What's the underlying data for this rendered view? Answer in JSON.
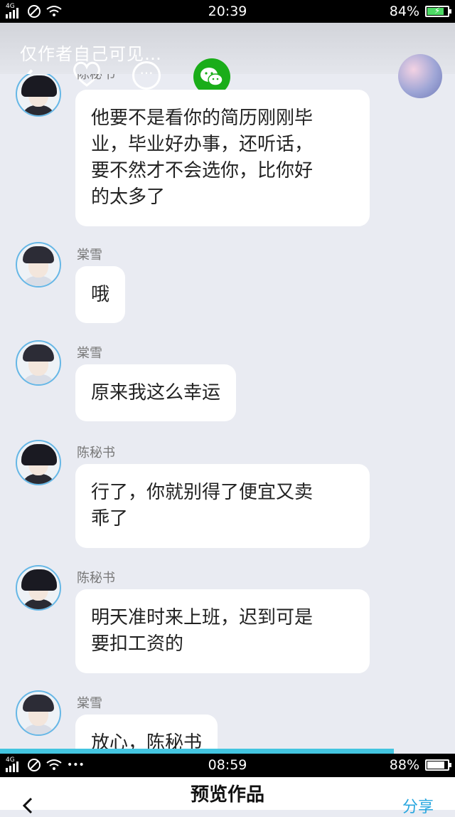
{
  "status_top": {
    "network": "4G",
    "time": "20:39",
    "battery": "84%",
    "battery_level": 0.84,
    "charging": true
  },
  "header": {
    "title": "仅作者自己可见…",
    "back_icon": "chevron-left-icon",
    "like_icon": "heart-icon",
    "more_icon": "more-icon",
    "share_icon": "wechat-icon"
  },
  "messages": [
    {
      "sender": "陈秘书",
      "text": "他要不是看你的简历刚刚毕\n业，毕业好办事，还听话，\n要不然才不会选你，比你好\n的太多了"
    },
    {
      "sender": "棠雪",
      "text": "哦"
    },
    {
      "sender": "棠雪",
      "text": "原来我这么幸运"
    },
    {
      "sender": "陈秘书",
      "text": "行了，你就别得了便宜又卖\n乖了"
    },
    {
      "sender": "陈秘书",
      "text": "明天准时来上班，迟到可是\n要扣工资的"
    },
    {
      "sender": "棠雪",
      "text": "放心，陈秘书"
    }
  ],
  "reading_progress": 0.865,
  "status_bottom": {
    "network": "4G",
    "time": "08:59",
    "battery": "88%",
    "battery_level": 0.88
  },
  "footer": {
    "back_icon": "chevron-left-icon",
    "title": "预览作品",
    "share": "分享"
  }
}
